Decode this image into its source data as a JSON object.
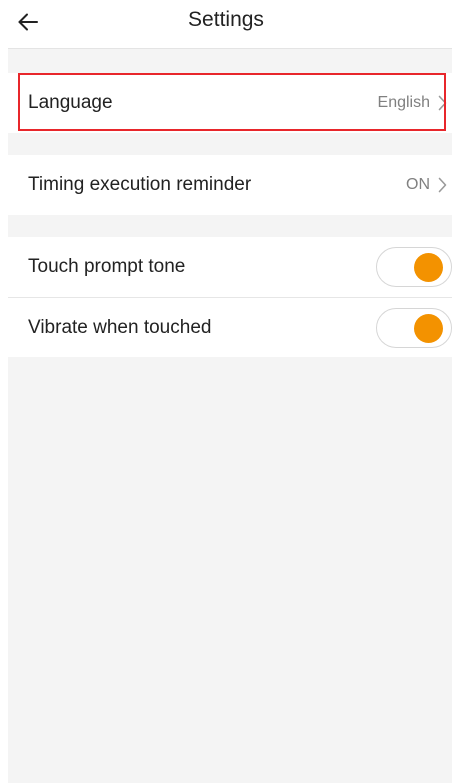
{
  "header": {
    "title": "Settings",
    "back_icon": "arrow-left-icon"
  },
  "settings": {
    "language": {
      "label": "Language",
      "value": "English"
    },
    "timing_reminder": {
      "label": "Timing execution reminder",
      "value": "ON"
    },
    "touch_tone": {
      "label": "Touch prompt tone",
      "enabled": true
    },
    "vibrate": {
      "label": "Vibrate when touched",
      "enabled": true
    }
  },
  "colors": {
    "accent": "#f39200",
    "highlight": "#e8262b",
    "background": "#f4f4f4"
  }
}
